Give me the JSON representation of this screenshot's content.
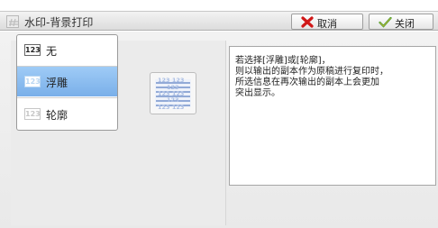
{
  "window": {
    "title": "水印-背景打印",
    "icon": "watermark-icon"
  },
  "toolbar": {
    "cancel_label": "取消",
    "cancel_icon": "x-mark-icon",
    "close_label": "关闭",
    "close_icon": "checkmark-icon"
  },
  "options": {
    "selected": "浮雕",
    "items": [
      {
        "badge": "123",
        "label": "无"
      },
      {
        "badge": "123",
        "label": "浮雕"
      },
      {
        "badge": "123",
        "label": "轮廓"
      }
    ]
  },
  "illustration": {
    "icon": "emboss-preview-icon",
    "rows": [
      "123 123",
      "123",
      "123 123",
      "123",
      "123 123"
    ]
  },
  "description": {
    "lines": [
      "若选择[浮雕]或[轮廓]，",
      "则以输出的副本作为原稿进行复印时，",
      "所选信息在再次输出的副本上会更加",
      "突出显示。"
    ]
  },
  "colors": {
    "selected_bg": "#8dbdf0",
    "cancel_icon": "#d01818",
    "close_icon": "#3a9a2a"
  }
}
